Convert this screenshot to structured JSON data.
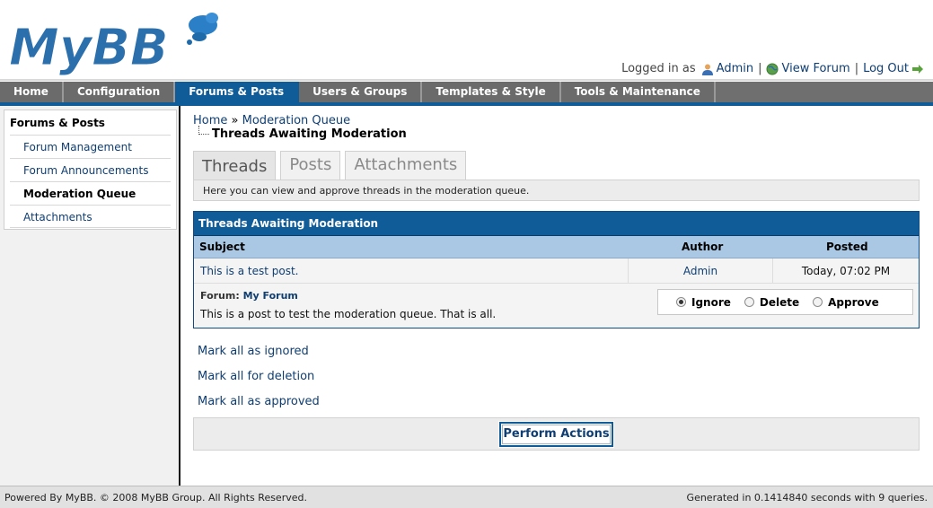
{
  "header": {
    "logo_text": "MyBB",
    "logged_in_as": "Logged in as",
    "user_name": "Admin",
    "view_forum": "View Forum",
    "log_out": "Log Out"
  },
  "menu": {
    "items": [
      {
        "label": "Home"
      },
      {
        "label": "Configuration"
      },
      {
        "label": "Forums & Posts",
        "active": true
      },
      {
        "label": "Users & Groups"
      },
      {
        "label": "Templates & Style"
      },
      {
        "label": "Tools & Maintenance"
      }
    ]
  },
  "sidebar": {
    "title": "Forums & Posts",
    "items": [
      {
        "label": "Forum Management"
      },
      {
        "label": "Forum Announcements"
      },
      {
        "label": "Moderation Queue",
        "active": true
      },
      {
        "label": "Attachments"
      }
    ]
  },
  "breadcrumb": {
    "home": "Home",
    "separator": "»",
    "queue": "Moderation Queue",
    "current": "Threads Awaiting Moderation"
  },
  "tabs": [
    {
      "label": "Threads",
      "active": true
    },
    {
      "label": "Posts"
    },
    {
      "label": "Attachments"
    }
  ],
  "tab_description": "Here you can view and approve threads in the moderation queue.",
  "table": {
    "title": "Threads Awaiting Moderation",
    "columns": {
      "subject": "Subject",
      "author": "Author",
      "posted": "Posted"
    },
    "row": {
      "subject": "This is a test post.",
      "author": "Admin",
      "posted": "Today, 07:02 PM",
      "forum_label": "Forum:",
      "forum_name": "My Forum",
      "message": "This is a post to test the moderation queue. That is all.",
      "options": {
        "ignore": "Ignore",
        "delete": "Delete",
        "approve": "Approve",
        "selected": "Ignore"
      }
    }
  },
  "mark_links": {
    "ignored": "Mark all as ignored",
    "deletion": "Mark all for deletion",
    "approved": "Mark all as approved"
  },
  "perform_button": "Perform Actions",
  "footer": {
    "left": "Powered By MyBB. © 2008 MyBB Group. All Rights Reserved.",
    "right": "Generated in 0.1414840 seconds with 9 queries."
  },
  "colors": {
    "brand_blue": "#0f5c99",
    "link": "#0f3e73",
    "column_header": "#aac8e4"
  }
}
